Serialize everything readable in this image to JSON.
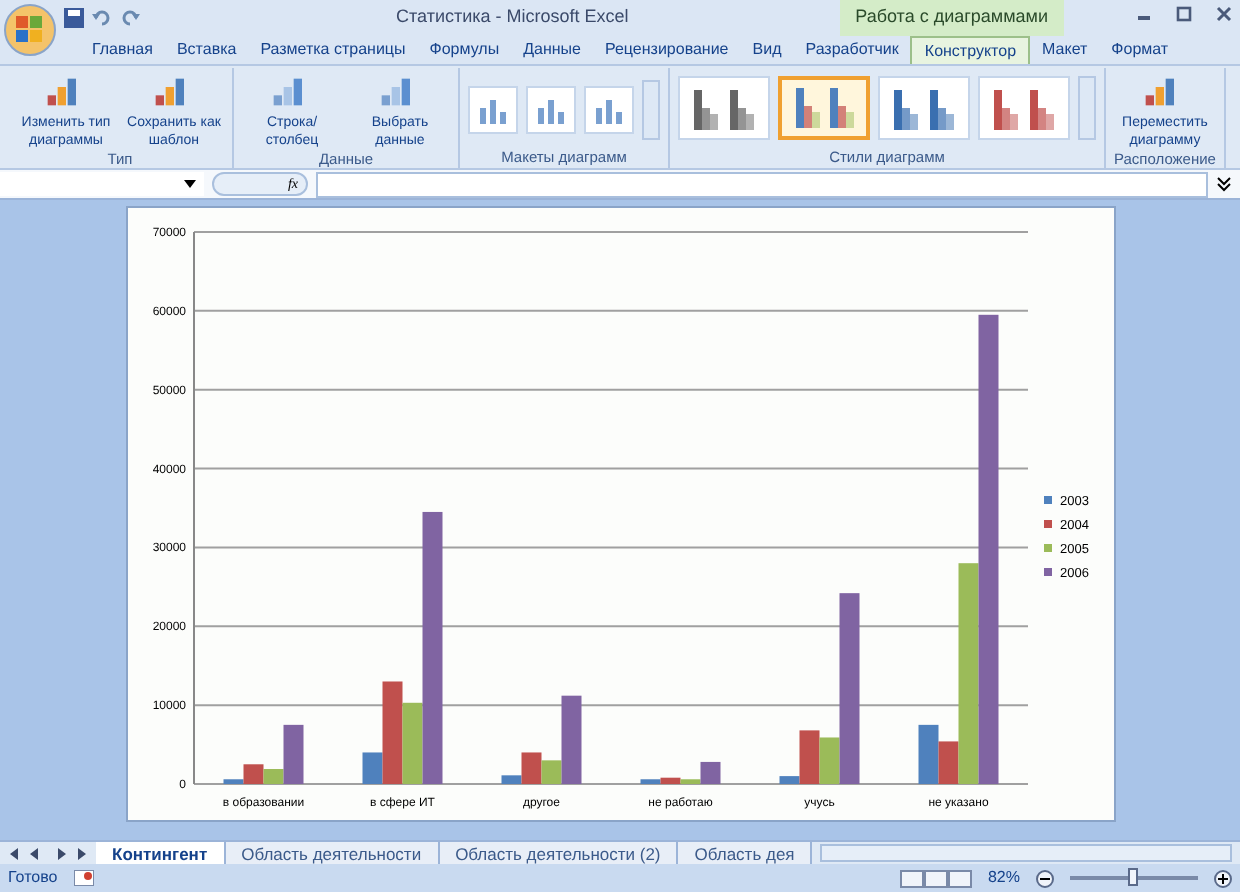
{
  "window": {
    "title": "Статистика - Microsoft Excel",
    "context_tab_group": "Работа с диаграммами"
  },
  "tabs": [
    {
      "label": "Главная",
      "selected": false
    },
    {
      "label": "Вставка",
      "selected": false
    },
    {
      "label": "Разметка страницы",
      "selected": false
    },
    {
      "label": "Формулы",
      "selected": false
    },
    {
      "label": "Данные",
      "selected": false
    },
    {
      "label": "Рецензирование",
      "selected": false
    },
    {
      "label": "Вид",
      "selected": false
    },
    {
      "label": "Разработчик",
      "selected": false
    },
    {
      "label": "Конструктор",
      "selected": true
    },
    {
      "label": "Макет",
      "selected": false
    },
    {
      "label": "Формат",
      "selected": false
    }
  ],
  "ribbon": {
    "groups": [
      {
        "label": "Тип",
        "kind": "buttons",
        "buttons": [
          {
            "label": "Изменить тип диаграммы"
          },
          {
            "label": "Сохранить как шаблон"
          }
        ]
      },
      {
        "label": "Данные",
        "kind": "buttons",
        "buttons": [
          {
            "label": "Строка/столбец"
          },
          {
            "label": "Выбрать данные"
          }
        ]
      },
      {
        "label": "Макеты диаграмм",
        "kind": "layouts"
      },
      {
        "label": "Стили диаграмм",
        "kind": "styles",
        "styles": [
          {
            "color": "#666666",
            "selected": false
          },
          {
            "color": "#4f81bd",
            "selected": true
          },
          {
            "color": "#3a6fb0",
            "selected": false
          },
          {
            "color": "#c0504d",
            "selected": false
          }
        ]
      },
      {
        "label": "Расположение",
        "kind": "buttons",
        "buttons": [
          {
            "label": "Переместить диаграмму"
          }
        ]
      }
    ]
  },
  "formula_bar": {
    "function_label": "fx"
  },
  "chart": {
    "chart_data": {
      "type": "bar",
      "grid": true,
      "legend": "right",
      "categories": [
        "в образовании",
        "в сфере ИТ",
        "другое",
        "не работаю",
        "учусь",
        "не указано"
      ],
      "ylim": [
        0,
        70000
      ],
      "yticks": [
        0,
        10000,
        20000,
        30000,
        40000,
        50000,
        60000,
        70000
      ],
      "series": [
        {
          "name": "2003",
          "color": "#4f81bd",
          "values": [
            600,
            4000,
            1100,
            600,
            1000,
            7500
          ]
        },
        {
          "name": "2004",
          "color": "#c0504d",
          "values": [
            2500,
            13000,
            4000,
            800,
            6800,
            5400
          ]
        },
        {
          "name": "2005",
          "color": "#9bbb59",
          "values": [
            1900,
            10300,
            3000,
            600,
            5900,
            28000
          ]
        },
        {
          "name": "2006",
          "color": "#8064a2",
          "values": [
            7500,
            34500,
            11200,
            2800,
            24200,
            59500
          ]
        }
      ]
    }
  },
  "sheet_tabs": [
    {
      "label": "Контингент",
      "selected": true
    },
    {
      "label": "Область деятельности",
      "selected": false
    },
    {
      "label": "Область деятельности (2)",
      "selected": false
    },
    {
      "label": "Область дея",
      "selected": false
    }
  ],
  "status_bar": {
    "status": "Готово",
    "zoom": "82%",
    "zoom_slider": {
      "level": 0.48
    }
  }
}
